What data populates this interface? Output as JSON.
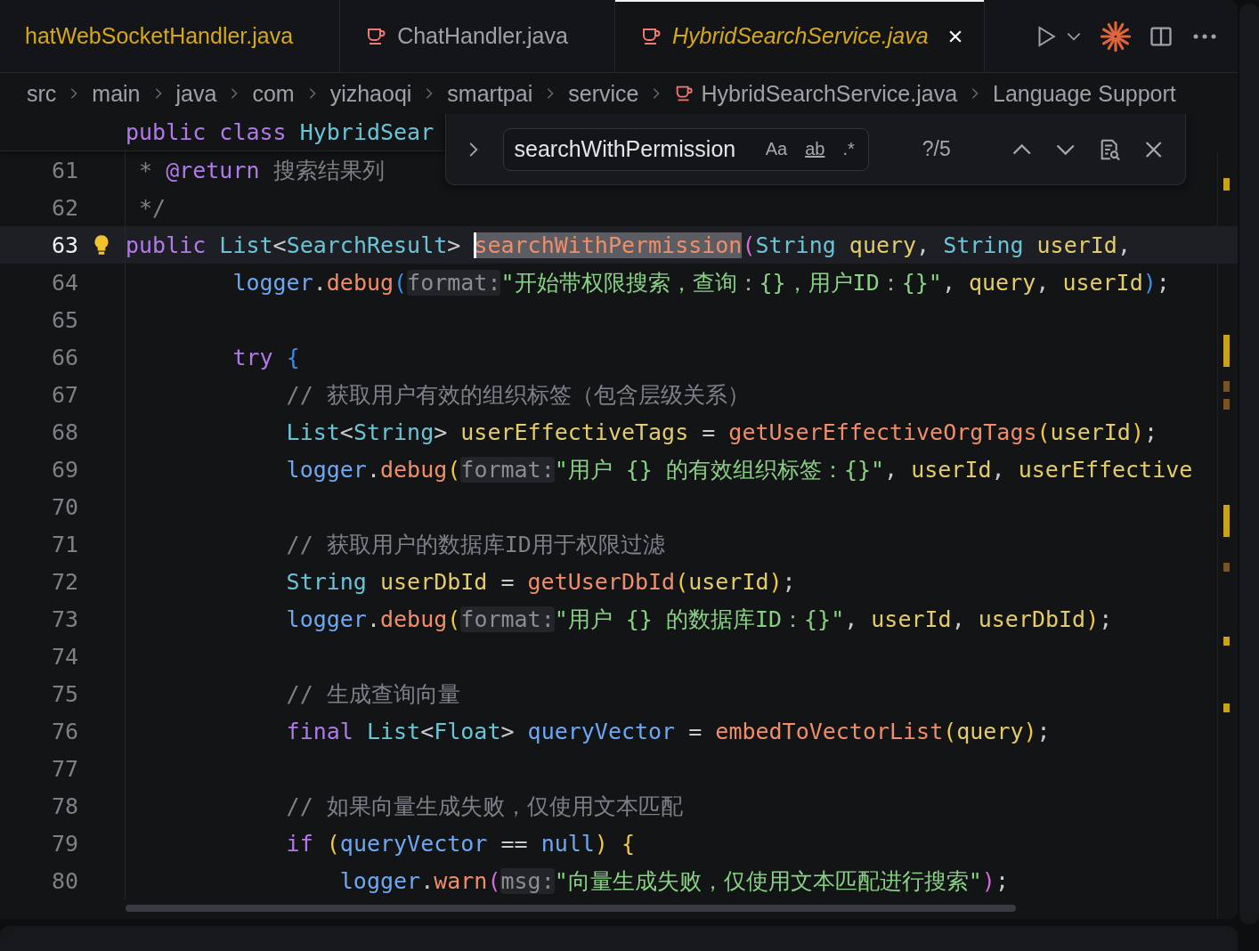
{
  "tabs": [
    {
      "label": "hatWebSocketHandler.java",
      "selected": false,
      "preview": false,
      "warning": true,
      "show_icon": false
    },
    {
      "label": "ChatHandler.java",
      "selected": false,
      "preview": false,
      "warning": false,
      "show_icon": true
    },
    {
      "label": "HybridSearchService.java",
      "selected": true,
      "preview": true,
      "warning": true,
      "show_icon": true
    }
  ],
  "breadcrumbs": [
    {
      "kind": "folder",
      "label": "src"
    },
    {
      "kind": "folder",
      "label": "main"
    },
    {
      "kind": "folder",
      "label": "java"
    },
    {
      "kind": "folder",
      "label": "com"
    },
    {
      "kind": "folder",
      "label": "yizhaoqi"
    },
    {
      "kind": "folder",
      "label": "smartpai"
    },
    {
      "kind": "folder",
      "label": "service"
    },
    {
      "kind": "file",
      "label": "HybridSearchService.java"
    },
    {
      "kind": "symbol",
      "label": "Language Support"
    }
  ],
  "sticky_header": {
    "tokens": [
      {
        "kind": "kw",
        "text": "public class "
      },
      {
        "kind": "type",
        "text": "HybridSear"
      }
    ]
  },
  "find": {
    "value": "searchWithPermission",
    "options": [
      {
        "label": "Aa",
        "selected": false
      },
      {
        "label": "ab",
        "selected": false
      },
      {
        "label": ".*",
        "selected": false
      }
    ],
    "count": "?/5"
  },
  "lines": [
    {
      "number": "61",
      "current": false,
      "tokens": [
        {
          "kind": "com",
          "text": " * "
        },
        {
          "kind": "doc",
          "text": "@return"
        },
        {
          "kind": "com",
          "text": " 搜索结果列"
        }
      ]
    },
    {
      "number": "62",
      "current": false,
      "tokens": [
        {
          "kind": "com",
          "text": " */"
        }
      ]
    },
    {
      "number": "63",
      "current": true,
      "tokens": [
        {
          "kind": "kw",
          "text": "public "
        },
        {
          "kind": "type",
          "text": "List"
        },
        {
          "kind": "punct",
          "text": "<"
        },
        {
          "kind": "type",
          "text": "SearchResult"
        },
        {
          "kind": "punct",
          "text": "> "
        },
        {
          "kind": "match",
          "text": "searchWithPermission"
        },
        {
          "kind": "p2",
          "text": "("
        },
        {
          "kind": "type",
          "text": "String "
        },
        {
          "kind": "var",
          "text": "query"
        },
        {
          "kind": "punct",
          "text": ", "
        },
        {
          "kind": "type",
          "text": "String "
        },
        {
          "kind": "var",
          "text": "userId"
        },
        {
          "kind": "punct",
          "text": ","
        }
      ]
    },
    {
      "number": "64",
      "current": false,
      "tokens": [
        {
          "kind": "obj",
          "text": "        logger"
        },
        {
          "kind": "punct",
          "text": "."
        },
        {
          "kind": "method",
          "text": "debug"
        },
        {
          "kind": "p3",
          "text": "("
        },
        {
          "kind": "hint",
          "text": "format:"
        },
        {
          "kind": "str",
          "text": "\"开始带权限搜索，查询：{}，用户ID：{}\""
        },
        {
          "kind": "punct",
          "text": ", "
        },
        {
          "kind": "var",
          "text": "query"
        },
        {
          "kind": "punct",
          "text": ", "
        },
        {
          "kind": "var",
          "text": "userId"
        },
        {
          "kind": "p3",
          "text": ")"
        },
        {
          "kind": "punct",
          "text": ";"
        }
      ]
    },
    {
      "number": "65",
      "current": false
    },
    {
      "number": "66",
      "current": false,
      "tokens": [
        {
          "kind": "kw",
          "text": "        try "
        },
        {
          "kind": "p3",
          "text": "{"
        }
      ]
    },
    {
      "number": "67",
      "current": false,
      "tokens": [
        {
          "kind": "com",
          "text": "            // 获取用户有效的组织标签（包含层级关系）"
        }
      ]
    },
    {
      "number": "68",
      "current": false,
      "tokens": [
        {
          "kind": "type",
          "text": "            List"
        },
        {
          "kind": "punct",
          "text": "<"
        },
        {
          "kind": "type",
          "text": "String"
        },
        {
          "kind": "punct",
          "text": "> "
        },
        {
          "kind": "var",
          "text": "userEffectiveTags"
        },
        {
          "kind": "punct",
          "text": " = "
        },
        {
          "kind": "method",
          "text": "getUserEffectiveOrgTags"
        },
        {
          "kind": "p1",
          "text": "("
        },
        {
          "kind": "var",
          "text": "userId"
        },
        {
          "kind": "p1",
          "text": ")"
        },
        {
          "kind": "punct",
          "text": ";"
        }
      ]
    },
    {
      "number": "69",
      "current": false,
      "tokens": [
        {
          "kind": "obj",
          "text": "            logger"
        },
        {
          "kind": "punct",
          "text": "."
        },
        {
          "kind": "method",
          "text": "debug"
        },
        {
          "kind": "p1",
          "text": "("
        },
        {
          "kind": "hint",
          "text": "format:"
        },
        {
          "kind": "str",
          "text": "\"用户 {} 的有效组织标签：{}\""
        },
        {
          "kind": "punct",
          "text": ", "
        },
        {
          "kind": "var",
          "text": "userId"
        },
        {
          "kind": "punct",
          "text": ", "
        },
        {
          "kind": "var",
          "text": "userEffective"
        }
      ]
    },
    {
      "number": "70",
      "current": false
    },
    {
      "number": "71",
      "current": false,
      "tokens": [
        {
          "kind": "com",
          "text": "            // 获取用户的数据库ID用于权限过滤"
        }
      ]
    },
    {
      "number": "72",
      "current": false,
      "tokens": [
        {
          "kind": "type",
          "text": "            String "
        },
        {
          "kind": "var",
          "text": "userDbId"
        },
        {
          "kind": "punct",
          "text": " = "
        },
        {
          "kind": "method",
          "text": "getUserDbId"
        },
        {
          "kind": "p1",
          "text": "("
        },
        {
          "kind": "var",
          "text": "userId"
        },
        {
          "kind": "p1",
          "text": ")"
        },
        {
          "kind": "punct",
          "text": ";"
        }
      ]
    },
    {
      "number": "73",
      "current": false,
      "tokens": [
        {
          "kind": "obj",
          "text": "            logger"
        },
        {
          "kind": "punct",
          "text": "."
        },
        {
          "kind": "method",
          "text": "debug"
        },
        {
          "kind": "p1",
          "text": "("
        },
        {
          "kind": "hint",
          "text": "format:"
        },
        {
          "kind": "str",
          "text": "\"用户 {} 的数据库ID：{}\""
        },
        {
          "kind": "punct",
          "text": ", "
        },
        {
          "kind": "var",
          "text": "userId"
        },
        {
          "kind": "punct",
          "text": ", "
        },
        {
          "kind": "var",
          "text": "userDbId"
        },
        {
          "kind": "p1",
          "text": ")"
        },
        {
          "kind": "punct",
          "text": ";"
        }
      ]
    },
    {
      "number": "74",
      "current": false
    },
    {
      "number": "75",
      "current": false,
      "tokens": [
        {
          "kind": "com",
          "text": "            // 生成查询向量"
        }
      ]
    },
    {
      "number": "76",
      "current": false,
      "tokens": [
        {
          "kind": "kw",
          "text": "            final "
        },
        {
          "kind": "type",
          "text": "List"
        },
        {
          "kind": "punct",
          "text": "<"
        },
        {
          "kind": "type",
          "text": "Float"
        },
        {
          "kind": "punct",
          "text": "> "
        },
        {
          "kind": "obj",
          "text": "queryVector"
        },
        {
          "kind": "punct",
          "text": " = "
        },
        {
          "kind": "method",
          "text": "embedToVectorList"
        },
        {
          "kind": "p1",
          "text": "("
        },
        {
          "kind": "var",
          "text": "query"
        },
        {
          "kind": "p1",
          "text": ")"
        },
        {
          "kind": "punct",
          "text": ";"
        }
      ]
    },
    {
      "number": "77",
      "current": false
    },
    {
      "number": "78",
      "current": false,
      "tokens": [
        {
          "kind": "com",
          "text": "            // 如果向量生成失败，仅使用文本匹配"
        }
      ]
    },
    {
      "number": "79",
      "current": false,
      "tokens": [
        {
          "kind": "kw",
          "text": "            if "
        },
        {
          "kind": "p1",
          "text": "("
        },
        {
          "kind": "obj",
          "text": "queryVector"
        },
        {
          "kind": "punct",
          "text": " == "
        },
        {
          "kind": "obj",
          "text": "null"
        },
        {
          "kind": "p1",
          "text": ") {"
        }
      ]
    },
    {
      "number": "80",
      "current": false,
      "tokens": [
        {
          "kind": "obj",
          "text": "                logger"
        },
        {
          "kind": "punct",
          "text": "."
        },
        {
          "kind": "method",
          "text": "warn"
        },
        {
          "kind": "p2",
          "text": "("
        },
        {
          "kind": "hint",
          "text": "msg:"
        },
        {
          "kind": "str",
          "text": "\"向量生成失败，仅使用文本匹配进行搜索\""
        },
        {
          "kind": "p2",
          "text": ")"
        },
        {
          "kind": "punct",
          "text": ";"
        }
      ]
    }
  ]
}
